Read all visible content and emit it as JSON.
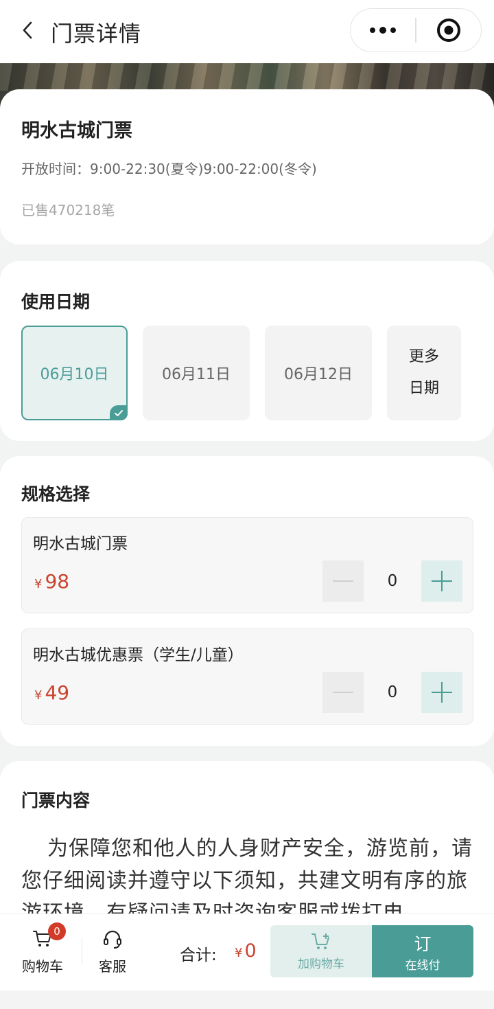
{
  "header": {
    "title": "门票详情",
    "back_icon": "chevron-left-icon",
    "more_icon": "more-dots-icon",
    "close_icon": "target-circle-icon"
  },
  "ticket": {
    "name": "明水古城门票",
    "open_time_label": "开放时间：",
    "open_time_value": "9:00-22:30(夏令)9:00-22:00(冬令)",
    "sold": "已售470218笔"
  },
  "date_section": {
    "title": "使用日期",
    "dates": [
      "06月10日",
      "06月11日",
      "06月12日"
    ],
    "selected_index": 0,
    "more_line1": "更多",
    "more_line2": "日期"
  },
  "spec_section": {
    "title": "规格选择",
    "items": [
      {
        "name": "明水古城门票",
        "currency": "¥",
        "price": "98",
        "qty": "0"
      },
      {
        "name": "明水古城优惠票（学生/儿童）",
        "currency": "¥",
        "price": "49",
        "qty": "0"
      }
    ]
  },
  "content_section": {
    "title": "门票内容",
    "text": "为保障您和他人的人身财产安全，游览前，请您仔细阅读并遵守以下须知，共建文明有序的旅游环境，有疑问请及时咨询客服或拨打电"
  },
  "bottom_bar": {
    "cart_label": "购物车",
    "cart_count": "0",
    "service_label": "客服",
    "total_label": "合计:",
    "total_currency": "¥",
    "total_value": "0",
    "add_cart_label": "加购物车",
    "order_big": "订",
    "order_small": "在线付"
  },
  "colors": {
    "accent": "#4a9d97",
    "price": "#c9442e",
    "badge": "#d23b27"
  }
}
